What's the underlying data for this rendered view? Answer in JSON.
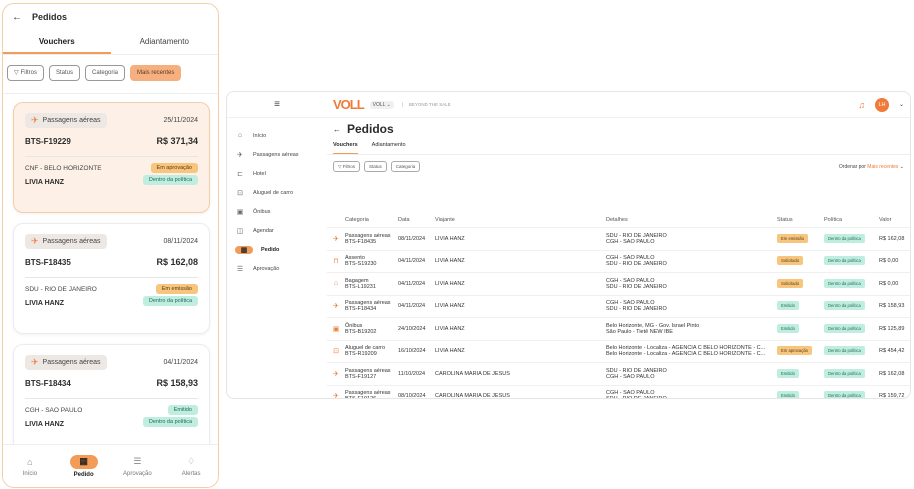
{
  "mobile": {
    "title": "Pedidos",
    "tabs": [
      "Vouchers",
      "Adiantamento"
    ],
    "filters": [
      "Filtros",
      "Status",
      "Categoria",
      "Mais recentes"
    ],
    "cards": [
      {
        "category": "Passagens aéreas",
        "date": "25/11/2024",
        "code": "BTS-F19229",
        "value": "R$ 371,34",
        "route": "CNF - BELO HORIZONTE",
        "status": "Em aprovação",
        "passenger": "LIVIA HANZ",
        "policy": "Dentro da política"
      },
      {
        "category": "Passagens aéreas",
        "date": "08/11/2024",
        "code": "BTS-F18435",
        "value": "R$ 162,08",
        "route": "SDU - RIO DE JANEIRO",
        "status": "Em emissão",
        "passenger": "LIVIA HANZ",
        "policy": "Dentro da política"
      },
      {
        "category": "Passagens aéreas",
        "date": "04/11/2024",
        "code": "BTS-F18434",
        "value": "R$ 158,93",
        "route": "CGH - SAO PAULO",
        "status": "Emitido",
        "passenger": "LIVIA HANZ",
        "policy": "Dentro da política"
      }
    ],
    "nav": [
      {
        "label": "Início",
        "icon": "home-icon"
      },
      {
        "label": "Pedido",
        "icon": "suitcase-icon"
      },
      {
        "label": "Aprovação",
        "icon": "checklist-icon"
      },
      {
        "label": "Alertas",
        "icon": "bell-icon"
      }
    ]
  },
  "desktop": {
    "logo": "VOLL",
    "voll_selector": "VOLL",
    "tagline": "BEYOND THE SALE",
    "avatar": "LH",
    "sidebar": [
      "Início",
      "Passagens aéreas",
      "Hotel",
      "Aluguel de carro",
      "Ônibus",
      "Agendar",
      "Pedido",
      "Aprovação"
    ],
    "title": "Pedidos",
    "tabs": [
      "Vouchers",
      "Adiantamento"
    ],
    "filters": [
      "Filtros",
      "Status",
      "Categoria"
    ],
    "order_label": "Ordenar por",
    "order_value": "Mais recentes",
    "columns": [
      "Categoria",
      "Data",
      "Viajante",
      "Detalhes",
      "Status",
      "Política",
      "Valor"
    ],
    "rows": [
      {
        "cat": "Passagens aéreas",
        "code": "BTS-F18435",
        "date": "08/11/2024",
        "traveler": "LIVIA HANZ",
        "d1": "SDU - RIO DE JANEIRO",
        "d2": "CGH - SAO PAULO",
        "status": "Em emissão",
        "status_color": "orange",
        "policy": "Dentro da política",
        "value": "R$ 162,08",
        "icon": "plane-icon"
      },
      {
        "cat": "Assento",
        "code": "BTS-S19230",
        "date": "04/11/2024",
        "traveler": "LIVIA HANZ",
        "d1": "CGH - SAO PAULO",
        "d2": "SDU - RIO DE JANEIRO",
        "status": "Solicitado",
        "status_color": "orange",
        "policy": "Dentro da política",
        "value": "R$ 0,00",
        "icon": "seat-icon"
      },
      {
        "cat": "Bagagem",
        "code": "BTS-L19231",
        "date": "04/11/2024",
        "traveler": "LIVIA HANZ",
        "d1": "CGH - SAO PAULO",
        "d2": "SDU - RIO DE JANEIRO",
        "status": "Solicitado",
        "status_color": "orange",
        "policy": "Dentro da política",
        "value": "R$ 0,00",
        "icon": "luggage-icon"
      },
      {
        "cat": "Passagens aéreas",
        "code": "BTS-F18434",
        "date": "04/11/2024",
        "traveler": "LIVIA HANZ",
        "d1": "CGH - SAO PAULO",
        "d2": "SDU - RIO DE JANEIRO",
        "status": "Emitido",
        "status_color": "green",
        "policy": "Dentro da política",
        "value": "R$ 158,93",
        "icon": "plane-icon"
      },
      {
        "cat": "Ônibus",
        "code": "BTS-B19202",
        "date": "24/10/2024",
        "traveler": "LIVIA HANZ",
        "d1": "Belo Horizonte, MG - Gov. Israel Pinto",
        "d2": "São Paulo - Tietê NEW IBE",
        "status": "Emitido",
        "status_color": "green",
        "policy": "Dentro da política",
        "value": "R$ 125,89",
        "icon": "bus-icon"
      },
      {
        "cat": "Aluguel de carro",
        "code": "BTS-R19209",
        "date": "16/10/2024",
        "traveler": "LIVIA HANZ",
        "d1": "Belo Horizonte - Localiza - AGENCIA C BELO HORIZONTE - C...",
        "d2": "Belo Horizonte - Localiza - AGENCIA C BELO HORIZONTE - C...",
        "status": "Em aprovação",
        "status_color": "orange",
        "policy": "Dentro da política",
        "value": "R$ 454,42",
        "icon": "car-icon"
      },
      {
        "cat": "Passagens aéreas",
        "code": "BTS-F19127",
        "date": "11/10/2024",
        "traveler": "CAROLINA MARIA DE JESUS",
        "d1": "SDU - RIO DE JANEIRO",
        "d2": "CGH - SAO PAULO",
        "status": "Emitido",
        "status_color": "green",
        "policy": "Dentro da política",
        "value": "R$ 162,08",
        "icon": "plane-icon"
      },
      {
        "cat": "Passagens aéreas",
        "code": "BTS-F19126",
        "date": "08/10/2024",
        "traveler": "CAROLINA MARIA DE JESUS",
        "d1": "CGH - SAO PAULO",
        "d2": "SDU - RIO DE JANEIRO",
        "status": "Emitido",
        "status_color": "green",
        "policy": "Dentro da política",
        "value": "R$ 159,72",
        "icon": "plane-icon"
      },
      {
        "cat": "Reembolso",
        "code": "BTS-E19241",
        "date": "02/10/2024",
        "traveler": "LIVIA HANZ",
        "d1": "Mobilidade",
        "d2": "Mobilidade",
        "status": "Em aprovação",
        "status_color": "orange",
        "policy": "Dentro da política",
        "value": "R$ 50,00",
        "icon": "receipt-icon"
      }
    ]
  }
}
